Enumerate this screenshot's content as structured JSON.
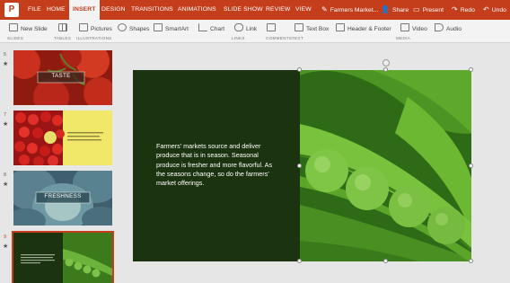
{
  "app": {
    "logo": "P",
    "doc_title": "Farmers Market..."
  },
  "tabs": [
    "FILE",
    "HOME",
    "INSERT",
    "DESIGN",
    "TRANSITIONS",
    "ANIMATIONS",
    "SLIDE SHOW",
    "REVIEW",
    "VIEW"
  ],
  "active_tab": "INSERT",
  "titlebar_actions": {
    "share": "Share",
    "present": "Present",
    "redo": "Redo",
    "undo": "Undo"
  },
  "ribbon": {
    "new_slide": "New Slide",
    "pictures": "Pictures",
    "shapes": "Shapes",
    "smartart": "SmartArt",
    "chart": "Chart",
    "link": "Link",
    "text_box": "Text Box",
    "header_footer": "Header & Footer",
    "video": "Video",
    "audio": "Audio"
  },
  "ribbon_groups": {
    "slides": "SLIDES",
    "tables": "TABLES",
    "illustrations": "ILLUSTRATIONS",
    "links": "LINKS",
    "comments": "COMMENTS",
    "text": "TEXT",
    "media": "MEDIA"
  },
  "slides": [
    {
      "number": "5",
      "star": "★",
      "title": "TASTE"
    },
    {
      "number": "7",
      "star": "★"
    },
    {
      "number": "8",
      "star": "★",
      "title": "FRESHNESS"
    },
    {
      "number": "9",
      "star": "★"
    }
  ],
  "slide_body": "Farmers' markets source and deliver produce that is in season. Seasonal produce is fresher and more flavorful. As the seasons change, so do the farmers' market offerings.",
  "colors": {
    "accent": "#c43e1c",
    "slide_bg": "#1c3310",
    "pea_green": "#4f9a26"
  }
}
